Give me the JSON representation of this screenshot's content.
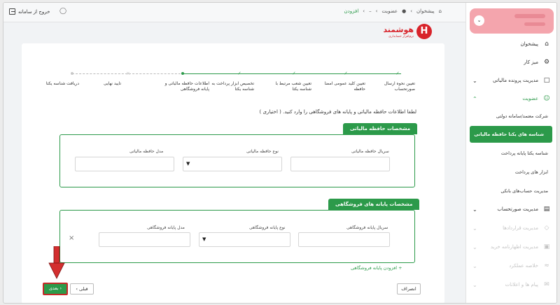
{
  "topbar": {
    "logout_label": "خروج از سامانه",
    "breadcrumb": [
      "پیشخوان",
      "عضویت",
      "افزودن"
    ]
  },
  "logo": {
    "mark": "H",
    "name": "هوشمند",
    "tagline": "نرم‌افزار حسابداری"
  },
  "sidebar": {
    "items": [
      {
        "label": "پیشخوان",
        "icon": "home-icon"
      },
      {
        "label": "میز کار",
        "icon": "desk-icon"
      },
      {
        "label": "مدیریت پرونده مالیاتی",
        "icon": "file-icon"
      },
      {
        "label": "عضویت",
        "icon": "user-icon"
      },
      {
        "label": "مدیریت صورتحساب",
        "icon": "invoice-icon"
      },
      {
        "label": "مدیریت قراردادها",
        "icon": "contract-icon"
      },
      {
        "label": "مدیریت اظهارنامه خرید",
        "icon": "purchase-icon"
      },
      {
        "label": "خلاصه عملکرد",
        "icon": "summary-icon"
      },
      {
        "label": "پیام ها و اعلانات",
        "icon": "message-icon"
      }
    ],
    "sub_items": [
      "شرکت معتمد/سامانه دولتی",
      "شناسه های یکتا حافظه مالیاتی",
      "شناسه یکتا پایانه پرداخت",
      "ابزار های پرداخت",
      "مدیریت حساب‌های بانکی"
    ]
  },
  "stepper": [
    "تعیین نحوه ارسال صورتحساب",
    "تعیین کلید عمومی امضا حافظه",
    "تعیین شعب مرتبط با شناسه یکتا",
    "تخصیص ابزار پرداخت به شناسه یکتا",
    "اطلاعات حافظه مالیاتی و پایانه فروشگاهی",
    "تایید نهایی",
    "دریافت شناسه یکتا"
  ],
  "form": {
    "instruction": "لطفا اطلاعات حافظه مالیاتی و پایانه های فروشگاهی را وارد کنید. ( اختیاری )",
    "memory": {
      "title": "مشخصات حافظه مالیاتی",
      "serial_label": "سریال حافظه مالیاتی",
      "type_label": "نوع حافظه مالیاتی",
      "model_label": "مدل حافظه مالیاتی"
    },
    "terminal": {
      "title": "مشخصات پایانه های فروشگاهی",
      "serial_label": "سریال پایانه فروشگاهی",
      "type_label": "نوع پایانه فروشگاهی",
      "model_label": "مدل پایانه فروشگاهی"
    },
    "add_terminal": "+ افزودن پایانه فروشگاهی"
  },
  "buttons": {
    "cancel": "انصراف",
    "prev": "قبلی",
    "next": "بعدی"
  }
}
